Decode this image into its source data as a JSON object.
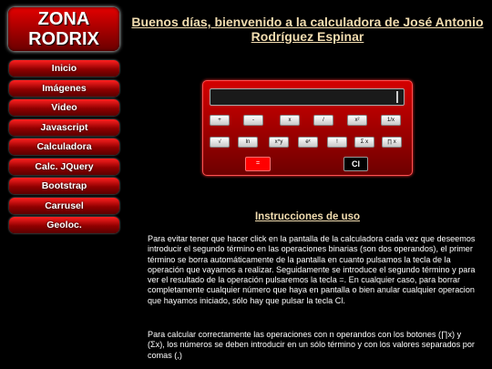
{
  "logo": {
    "line1": "ZONA",
    "line2": "RODRIX"
  },
  "nav": [
    "Inicio",
    "Imágenes",
    "Video",
    "Javascript",
    "Calculadora",
    "Calc. JQuery",
    "Bootstrap",
    "Carrusel",
    "Geoloc."
  ],
  "heading": "Buenos días, bienvenido a la calculadora de José Antonio Rodríguez Espinar",
  "calculator": {
    "display_value": "",
    "row1": [
      "+",
      "-",
      "x",
      "/",
      "x²",
      "1/x"
    ],
    "row2": [
      "√",
      "ln",
      "x^y",
      "eˣ",
      "!",
      "Σ x",
      "∏ x"
    ],
    "equals": "=",
    "clear": "Cl"
  },
  "instructions": {
    "title": "Instrucciones de uso",
    "p1": "Para evitar tener que hacer click en la pantalla de la calculadora cada vez que deseemos introducir el segundo término en las operaciones binarias (son dos operandos), el primer término se borra automáticamente de la pantalla en cuanto pulsamos la tecla de la operación que vayamos a realizar. Seguidamente se introduce el segundo término y para ver el resultado de la operación pulsaremos la tecla =. En cualquier caso, para borrar completamente cualquier número que haya en pantalla o bien anular cualquier operacion que hayamos iniciado, sólo hay que pulsar la tecla Cl.",
    "p2": "Para calcular correctamente las operaciones con n operandos con los botones (∏x) y (Σx), los números se deben introducir en un sólo término y con los valores separados por comas (,)"
  },
  "colors": {
    "accent": "#d40000",
    "heading": "#f2ddb0",
    "background": "#000000"
  }
}
